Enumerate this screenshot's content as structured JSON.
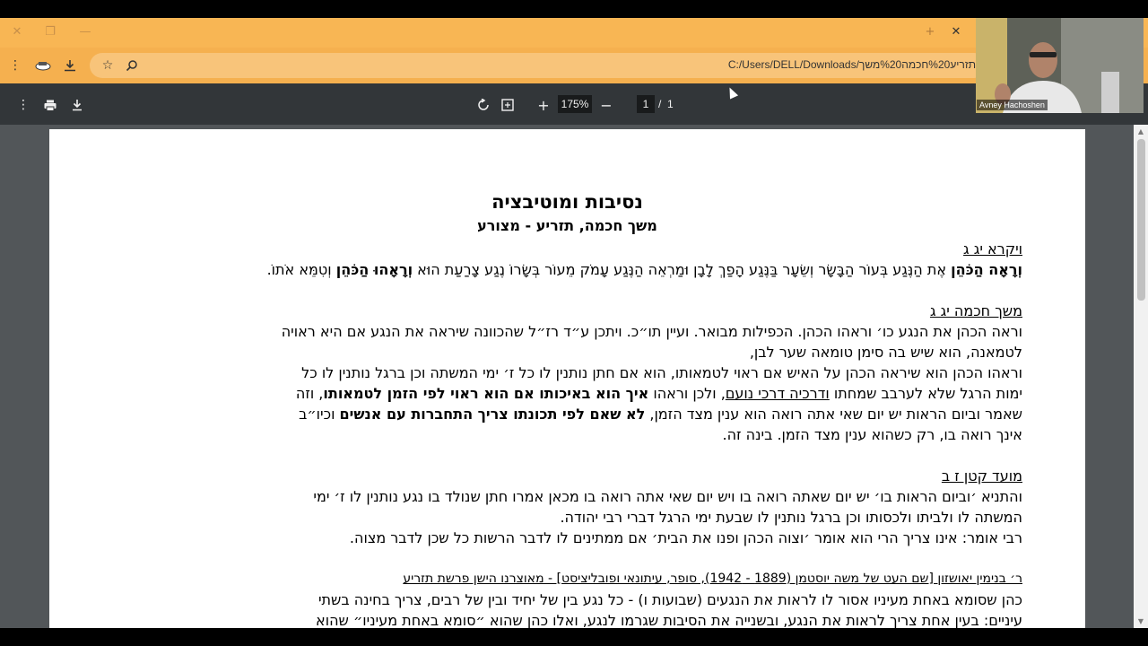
{
  "browser": {
    "address": "C:/Users/DELL/Downloads/תזריע%20חכמה%20משך",
    "new_tab_glyph": "+",
    "close_tab_glyph": "✕",
    "icons": [
      "menu-dots-icon",
      "extension-icon",
      "download-icon",
      "star-icon",
      "zoom-search-icon"
    ]
  },
  "pdf_toolbar": {
    "zoom": "175%",
    "current_page": "1",
    "page_separator": "/",
    "total_pages": "1",
    "icons": [
      "more-icon",
      "print-icon",
      "download-icon",
      "rotate-icon",
      "fit-page-icon",
      "zoom-in-icon",
      "zoom-out-icon"
    ]
  },
  "video": {
    "participant": "Avney Hachoshen"
  },
  "document": {
    "title": "נסיבות ומוטיבציה",
    "subtitle": "משך חכמה, תזריע - מצורע",
    "sec1_heading": "ויקרא יג ג",
    "sec1_line1a": "וְרָאָה הַכֹּהֵן",
    "sec1_line1b": " אֶת הַנֶּגַע בְּעוֹר הַבָּשָׂר וְשֵׂעָר בַּנֶּגַע הָפַךְ לָבָן וּמַרְאֵה הַנֶּגַע עָמֹק מֵעוֹר בְּשָׂרוֹ נֶגַע צָרַעַת הוּא ",
    "sec1_line1c": "וְרָאָהוּ הַכֹּהֵן",
    "sec1_line1d": " וְטִמֵּא אֹתוֹ.",
    "sec2_heading": "משך חכמה יג ג",
    "sec2_line1": "וראה הכהן את הנגע כו׳ וראהו הכהן. הכפילות מבואר. ועיין תו״כ. ויתכן ע״ד רז״ל שהכוונה שיראה את הנגע אם היא ראויה",
    "sec2_line2": "לטמאנה, הוא שיש בה סימן טומאה שער לבן,",
    "sec2_line3": "וראהו הכהן הוא שיראה הכהן על האיש אם ראוי לטמאותו, הוא אם חתן נותנין לו כל ז׳ ימי המשתה וכן ברגל נותנין לו כל",
    "sec2_line4a": "ימות הרגל שלא לערבב שמחתו ",
    "sec2_line4b": "ודרכיה דרכי נועם",
    "sec2_line4c": ", ולכן וראהו ",
    "sec2_line4d": "איך הוא באיכותו אם הוא ראוי לפי הזמן לטמאותו",
    "sec2_line4e": ", וזה",
    "sec2_line5a": "שאמר וביום הראות יש יום שאי אתה רואה הוא ענין מצד הזמן, ",
    "sec2_line5b": "לא שאם לפי תכונתו צריך התחברות עם אנשים",
    "sec2_line5c": " וכיו״ב",
    "sec2_line6": "אינך רואה בו, רק כשהוא ענין מצד הזמן. בינה זה.",
    "sec3_heading": "מועד קטן ז ב",
    "sec3_line1": "והתניא ׳וביום הראות בו׳ יש יום שאתה רואה בו ויש יום שאי אתה רואה בו מכאן אמרו חתן שנולד בו נגע נותנין לו ז׳ ימי",
    "sec3_line2": "המשתה לו ולביתו ולכסותו וכן ברגל נותנין לו שבעת ימי הרגל דברי רבי יהודה.",
    "sec3_line3": "רבי אומר: אינו צריך הרי הוא אומר ׳וצוה הכהן ופנו את הבית׳ אם ממתינים לו לדבר הרשות כל שכן לדבר מצוה.",
    "sec4_heading": "ר׳ בנימין יאושזון [שם העט של משה יוסטמן (1889 - 1942), סופר, עיתונאי ופובליציסט] - מאוצרנו הישן פרשת תזריע",
    "sec4_line1": "כהן שסומא באחת מעיניו אסור לו לראות את הנגעים (שבועות ו) - כל נגע בין של יחיד ובין של רבים, צריך בחינה בשתי",
    "sec4_line2": "עיניים: בעין אחת צריך לראות את הנגע, ובשנייה את הסיבות שגרמו לנגע, ואלו כהן שהוא ״סומא באחת מעיניו״ שהוא"
  }
}
